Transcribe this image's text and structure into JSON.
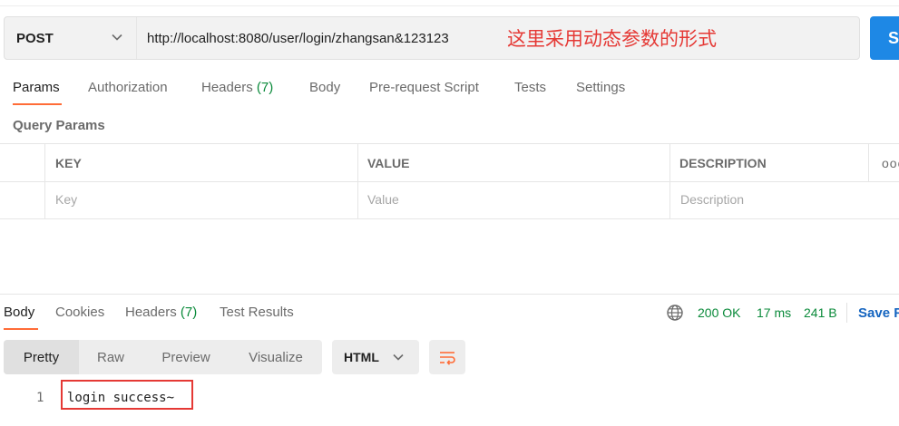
{
  "request": {
    "method": "POST",
    "url": "http://localhost:8080/user/login/zhangsan&123123",
    "annotation": "这里采用动态参数的形式",
    "send_label": "S"
  },
  "request_tabs": [
    {
      "label": "Params"
    },
    {
      "label": "Authorization"
    },
    {
      "label": "Headers",
      "count": "(7)"
    },
    {
      "label": "Body"
    },
    {
      "label": "Pre-request Script"
    },
    {
      "label": "Tests"
    },
    {
      "label": "Settings"
    }
  ],
  "query_params": {
    "title": "Query Params",
    "columns": [
      "KEY",
      "VALUE",
      "DESCRIPTION"
    ],
    "more": "ooo",
    "placeholders": [
      "Key",
      "Value",
      "Description"
    ]
  },
  "response": {
    "tabs": [
      {
        "label": "Body"
      },
      {
        "label": "Cookies"
      },
      {
        "label": "Headers",
        "count": "(7)"
      },
      {
        "label": "Test Results"
      }
    ],
    "status": "200 OK",
    "time": "17 ms",
    "size": "241 B",
    "save_label": "Save R",
    "views": [
      "Pretty",
      "Raw",
      "Preview",
      "Visualize"
    ],
    "format": "HTML",
    "lines": [
      {
        "number": "1",
        "text": "login success~"
      }
    ]
  },
  "colors": {
    "accent": "#ff6c37",
    "send": "#1e88e5",
    "status_ok": "#0a8a3a",
    "annotation": "#e53935"
  },
  "icons": [
    "chevron-down-icon",
    "globe-icon",
    "wrap-lines-icon"
  ]
}
